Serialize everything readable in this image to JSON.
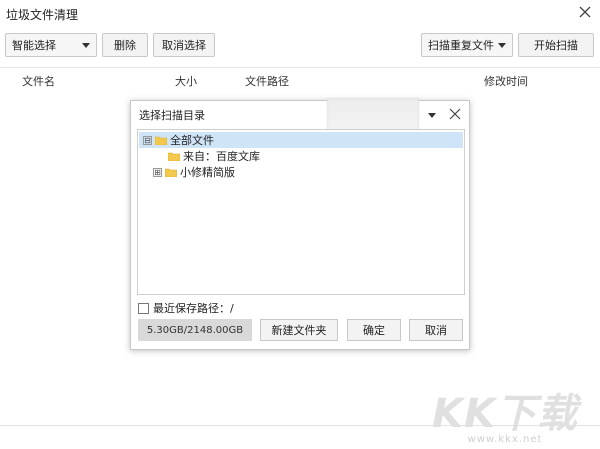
{
  "window": {
    "title": "垃圾文件清理"
  },
  "toolbar": {
    "smart_select": "智能选择",
    "delete": "删除",
    "cancel_select": "取消选择",
    "scan_mode": "扫描重复文件",
    "start_scan": "开始扫描"
  },
  "columns": [
    "文件名",
    "大小",
    "文件路径",
    "修改时间"
  ],
  "dialog": {
    "title": "选择扫描目录",
    "tree": [
      {
        "label": "全部文件",
        "expander": "⊟",
        "selected": true
      },
      {
        "label": "来自：百度文库",
        "expander": "",
        "selected": false
      },
      {
        "label": "小修精简版",
        "expander": "⊞",
        "selected": false
      }
    ],
    "recent_label": "最近保存路径：/",
    "disk_usage": "5.30GB/2148.00GB",
    "new_folder": "新建文件夹",
    "ok": "确定",
    "cancel": "取消"
  },
  "watermark": {
    "logo": "KK下载",
    "url": "www.kkx.net"
  },
  "colors": {
    "selection": "#cfe4f7",
    "folder": "#f2c94c",
    "button_bg": "#f3f3f3"
  }
}
